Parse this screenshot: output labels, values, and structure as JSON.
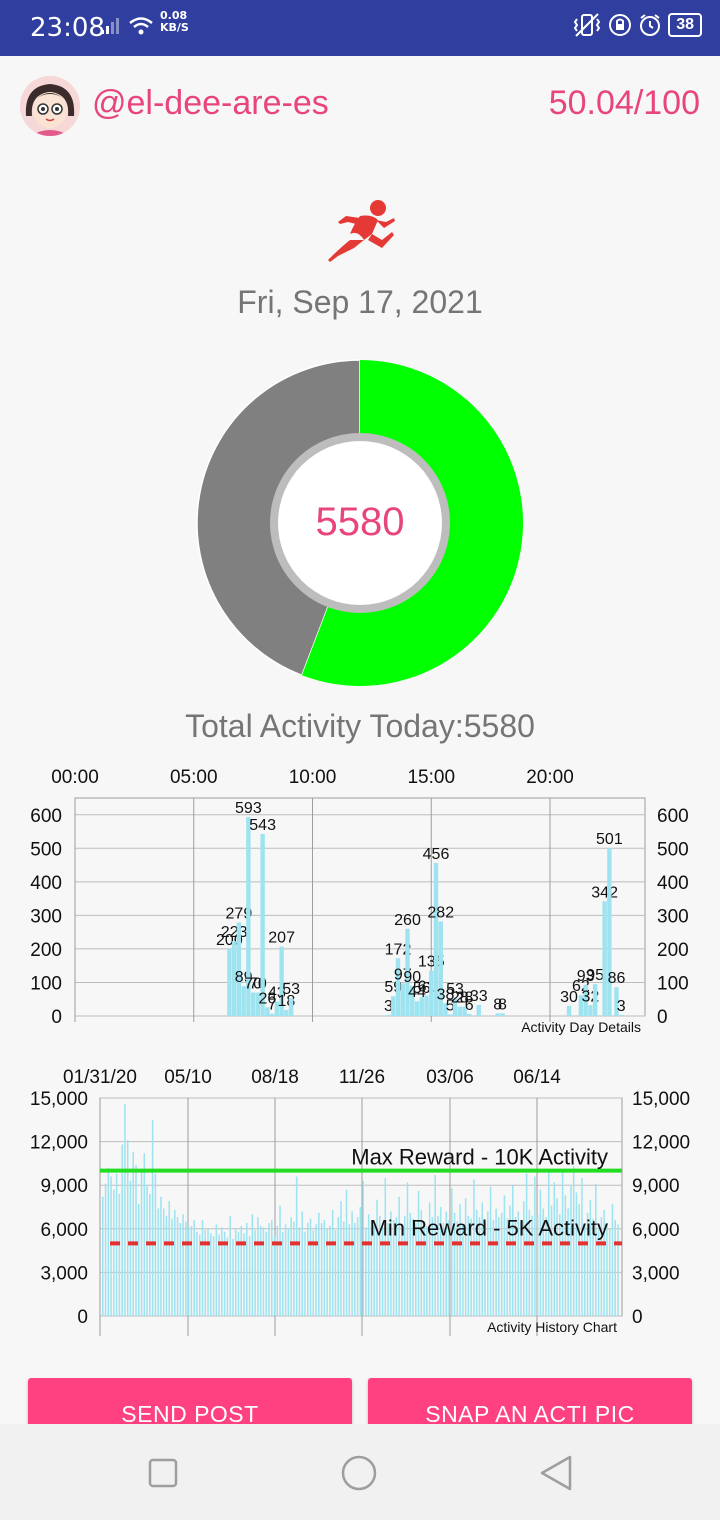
{
  "status_bar": {
    "time": "23:08",
    "net_speed_value": "0.08",
    "net_speed_unit": "KB/S",
    "battery": "38"
  },
  "header": {
    "username": "@el-dee-are-es",
    "score": "50.04/100"
  },
  "date": "Fri, Sep 17, 2021",
  "donut": {
    "value": "5580",
    "fraction": 0.558,
    "filled_color": "#00ff00",
    "remaining_color": "#808080"
  },
  "total_activity": "Total Activity Today:5580",
  "chart_data": [
    {
      "type": "bar",
      "description": "Activity Day Details",
      "x_tick_labels": [
        "00:00",
        "05:00",
        "10:00",
        "15:00",
        "20:00"
      ],
      "y_ticks": [
        0,
        100,
        200,
        300,
        400,
        500,
        600
      ],
      "ylim": [
        0,
        650
      ],
      "xlim_hours": [
        0,
        24
      ],
      "color": "#9ee3f0",
      "bars": [
        {
          "x": 6.5,
          "v": 200,
          "label": "200"
        },
        {
          "x": 6.7,
          "v": 223,
          "label": "223"
        },
        {
          "x": 6.9,
          "v": 279,
          "label": "279"
        },
        {
          "x": 7.1,
          "v": 89,
          "label": "89"
        },
        {
          "x": 7.3,
          "v": 593,
          "label": "593"
        },
        {
          "x": 7.5,
          "v": 70,
          "label": "70"
        },
        {
          "x": 7.7,
          "v": 70,
          "label": "70"
        },
        {
          "x": 7.9,
          "v": 543,
          "label": "543"
        },
        {
          "x": 8.1,
          "v": 26,
          "label": "26"
        },
        {
          "x": 8.3,
          "v": 7,
          "label": "7"
        },
        {
          "x": 8.5,
          "v": 43,
          "label": "43"
        },
        {
          "x": 8.7,
          "v": 207,
          "label": "207"
        },
        {
          "x": 8.9,
          "v": 18,
          "label": "18"
        },
        {
          "x": 9.1,
          "v": 53,
          "label": "53"
        },
        {
          "x": 13.2,
          "v": 3,
          "label": "3"
        },
        {
          "x": 13.4,
          "v": 59,
          "label": "59"
        },
        {
          "x": 13.6,
          "v": 172,
          "label": "172"
        },
        {
          "x": 13.8,
          "v": 97,
          "label": "97"
        },
        {
          "x": 14.0,
          "v": 260,
          "label": "260"
        },
        {
          "x": 14.2,
          "v": 90,
          "label": "90"
        },
        {
          "x": 14.4,
          "v": 44,
          "label": "44"
        },
        {
          "x": 14.6,
          "v": 56,
          "label": "56"
        },
        {
          "x": 14.8,
          "v": 61,
          "label": "61"
        },
        {
          "x": 15.0,
          "v": 135,
          "label": "135"
        },
        {
          "x": 15.2,
          "v": 456,
          "label": "456"
        },
        {
          "x": 15.4,
          "v": 282,
          "label": "282"
        },
        {
          "x": 15.6,
          "v": 38,
          "label": "38"
        },
        {
          "x": 15.8,
          "v": 5,
          "label": "5"
        },
        {
          "x": 16.0,
          "v": 53,
          "label": "53"
        },
        {
          "x": 16.2,
          "v": 28,
          "label": "28"
        },
        {
          "x": 16.4,
          "v": 28,
          "label": "28"
        },
        {
          "x": 16.6,
          "v": 6,
          "label": "6"
        },
        {
          "x": 17.0,
          "v": 33,
          "label": "33"
        },
        {
          "x": 17.8,
          "v": 8,
          "label": "8"
        },
        {
          "x": 18.0,
          "v": 8,
          "label": "8"
        },
        {
          "x": 20.8,
          "v": 30,
          "label": "30"
        },
        {
          "x": 21.3,
          "v": 62,
          "label": "62"
        },
        {
          "x": 21.5,
          "v": 93,
          "label": "93"
        },
        {
          "x": 21.7,
          "v": 32,
          "label": "32"
        },
        {
          "x": 21.9,
          "v": 95,
          "label": "95"
        },
        {
          "x": 22.3,
          "v": 342,
          "label": "342"
        },
        {
          "x": 22.5,
          "v": 501,
          "label": "501"
        },
        {
          "x": 22.8,
          "v": 86,
          "label": "86"
        },
        {
          "x": 23.0,
          "v": 3,
          "label": "3"
        }
      ]
    },
    {
      "type": "bar",
      "description": "Activity History Chart",
      "x_tick_labels": [
        "01/31/20",
        "05/10",
        "08/18",
        "11/26",
        "03/06",
        "06/14"
      ],
      "y_tick_labels": [
        "0",
        "3,000",
        "6,000",
        "9,000",
        "12,000",
        "15,000"
      ],
      "ylim": [
        0,
        15000
      ],
      "color": "#9ee3f0",
      "values": [
        8200,
        9100,
        10200,
        9600,
        8700,
        9800,
        8400,
        11800,
        14600,
        12100,
        9300,
        11300,
        10400,
        7700,
        9900,
        11200,
        9000,
        8400,
        13500,
        9800,
        7400,
        8200,
        7400,
        6900,
        7900,
        6700,
        7300,
        6800,
        6400,
        7000,
        6500,
        6100,
        6200,
        6600,
        5800,
        5600,
        6600,
        5900,
        6000,
        5700,
        5500,
        6300,
        5600,
        6100,
        5800,
        5400,
        6900,
        5300,
        6000,
        5800,
        6200,
        5700,
        6400,
        5500,
        7000,
        5900,
        6800,
        6200,
        6100,
        5800,
        6400,
        6600,
        5500,
        6200,
        7600,
        5800,
        6300,
        6000,
        6800,
        6500,
        9600,
        6100,
        7200,
        5800,
        6400,
        6700,
        5900,
        6300,
        7100,
        6400,
        6600,
        6000,
        6200,
        7300,
        5900,
        6800,
        7900,
        6500,
        8700,
        6300,
        7200,
        6400,
        6800,
        7500,
        9300,
        6100,
        7000,
        6600,
        6200,
        8000,
        6900,
        6100,
        9500,
        6400,
        7200,
        6600,
        6800,
        8200,
        6300,
        6900,
        9200,
        7100,
        6700,
        6400,
        8600,
        7300,
        6500,
        6200,
        7800,
        6800,
        9700,
        6900,
        7500,
        6400,
        7200,
        6600,
        8800,
        7100,
        6500,
        7700,
        6300,
        8100,
        6900,
        6700,
        9400,
        7300,
        6800,
        7800,
        6500,
        7200,
        8900,
        6600,
        7400,
        6800,
        7100,
        8300,
        6700,
        7600,
        9000,
        6800,
        7200,
        6500,
        7900,
        9800,
        7300,
        6900,
        9600,
        7000,
        8700,
        7400,
        6800,
        9900,
        7600,
        9200,
        8100,
        7000,
        10100,
        8300,
        7400,
        9000,
        10300,
        8500,
        7700,
        9500,
        6200,
        7100,
        8000,
        6700,
        9100,
        5900,
        6800,
        7300,
        6400,
        6000,
        7700,
        6600,
        6300
      ]
    }
  ],
  "day_chart": {
    "caption": "Activity Day Details"
  },
  "history_chart": {
    "caption": "Activity History Chart",
    "max_line": {
      "label": "Max Reward - 10K Activity",
      "value": 10000,
      "color": "#22dd22"
    },
    "min_line": {
      "label": "Min Reward - 5K Activity",
      "value": 5000,
      "color": "#e53030"
    }
  },
  "buttons": {
    "send_post": "SEND POST",
    "snap": "SNAP AN ACTI PIC"
  }
}
